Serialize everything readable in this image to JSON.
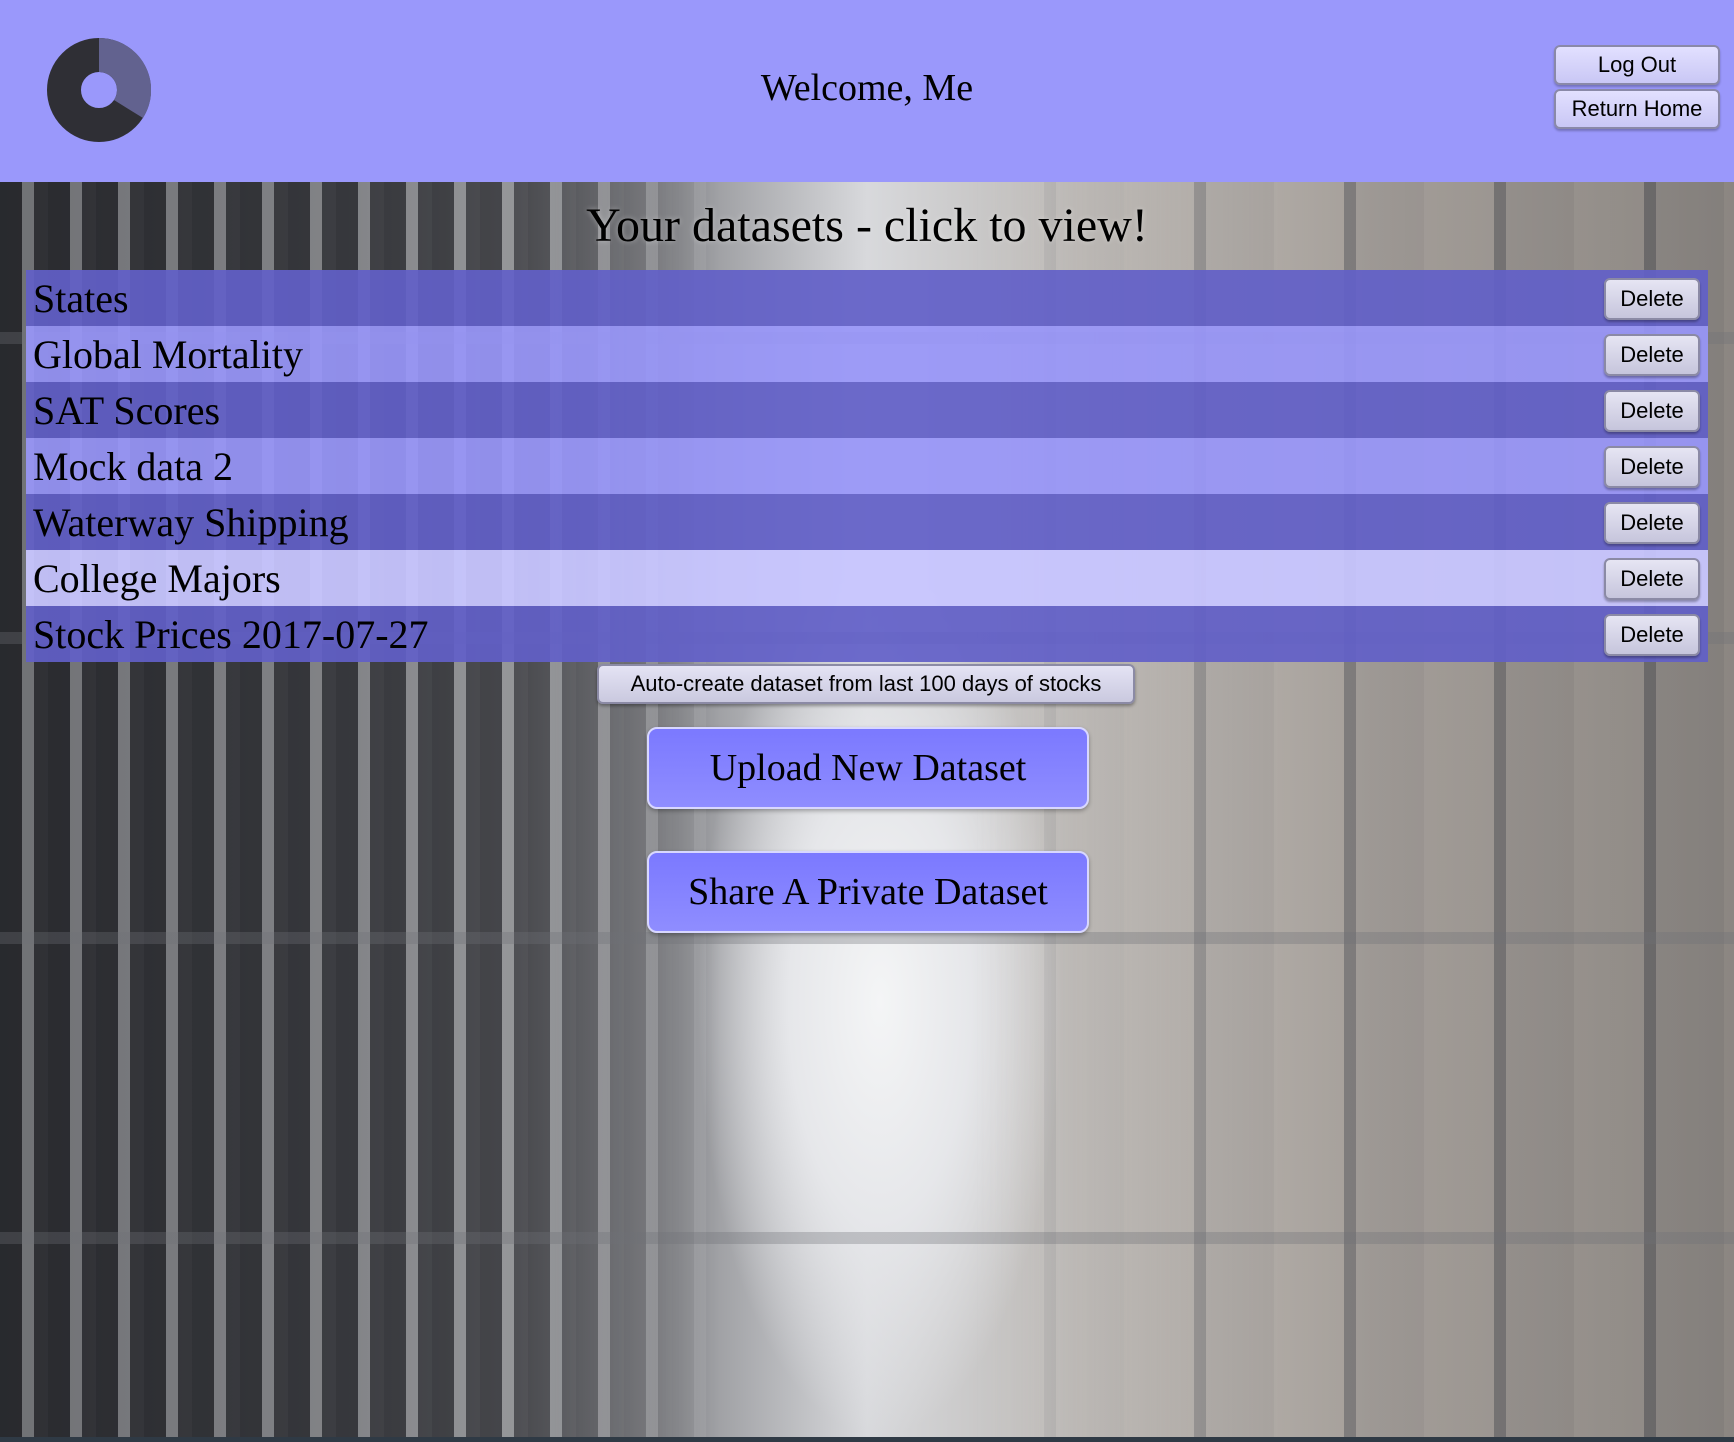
{
  "header": {
    "logo_icon": "donut-logo-icon",
    "welcome": "Welcome, Me",
    "logout_label": "Log Out",
    "home_label": "Return Home",
    "bg_color": "#9a98fb"
  },
  "main": {
    "heading": "Your datasets - click to view!",
    "datasets": [
      {
        "name": "States",
        "delete_label": "Delete"
      },
      {
        "name": "Global Mortality",
        "delete_label": "Delete"
      },
      {
        "name": "SAT Scores",
        "delete_label": "Delete"
      },
      {
        "name": "Mock data 2",
        "delete_label": "Delete"
      },
      {
        "name": "Waterway Shipping",
        "delete_label": "Delete"
      },
      {
        "name": "College Majors",
        "delete_label": "Delete"
      },
      {
        "name": "Stock Prices 2017-07-27",
        "delete_label": "Delete"
      }
    ],
    "auto_create_label": "Auto-create dataset from last 100 days of stocks",
    "upload_label": "Upload New Dataset",
    "share_label": "Share A Private Dataset"
  },
  "colors": {
    "row_dark": "#6260c8",
    "row_light": "#9896f8",
    "row_highlight": "#c8c6ff",
    "big_button": "#8482ff"
  }
}
